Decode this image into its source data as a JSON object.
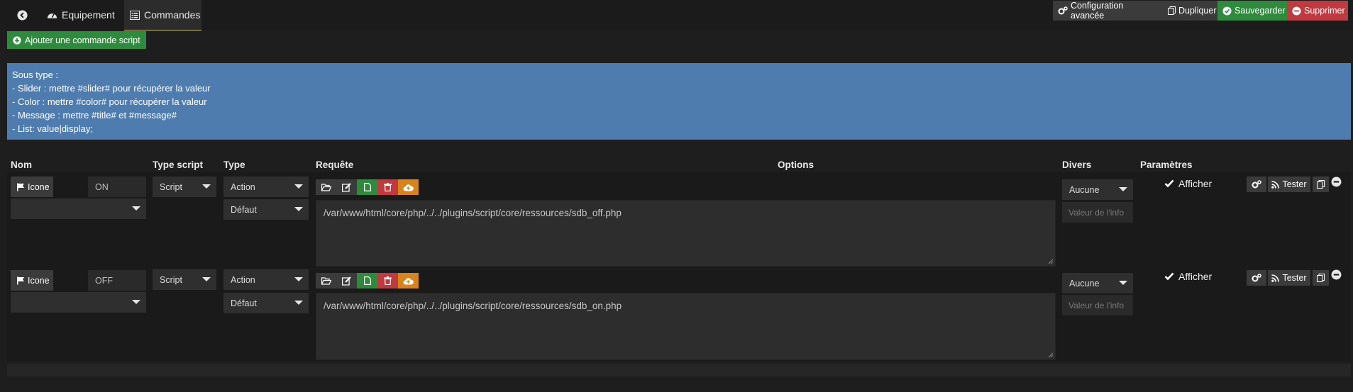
{
  "tabs": {
    "back_icon": "arrow-left-circle-icon",
    "equipement": "Equipement",
    "commandes": "Commandes"
  },
  "toolbar": {
    "config_avancee": "Configuration avancée",
    "dupliquer": "Dupliquer",
    "sauvegarder": "Sauvegarder",
    "supprimer": "Supprimer"
  },
  "add_command": "Ajouter une commande script",
  "info_box": {
    "line1": "Sous type :",
    "line2": "- Slider : mettre #slider# pour récupérer la valeur",
    "line3": "- Color : mettre #color# pour récupérer la valeur",
    "line4": "- Message : mettre #title# et #message#",
    "line5": "- List: value|display;"
  },
  "table": {
    "headers": {
      "nom": "Nom",
      "type_script": "Type script",
      "type": "Type",
      "requete": "Requête",
      "options": "Options",
      "divers": "Divers",
      "parametres": "Paramètres"
    },
    "rows": [
      {
        "icone": "Icone",
        "name": "ON",
        "type_script": "Script",
        "type": "Action",
        "subtype": "Défaut",
        "request": "/var/www/html/core/php/../../plugins/script/core/ressources/sdb_off.php",
        "divers": "Aucune",
        "valeur_placeholder": "Valeur de l'info",
        "afficher": "Afficher",
        "tester": "Tester"
      },
      {
        "icone": "Icone",
        "name": "OFF",
        "type_script": "Script",
        "type": "Action",
        "subtype": "Défaut",
        "request": "/var/www/html/core/php/../../plugins/script/core/ressources/sdb_on.php",
        "divers": "Aucune",
        "valeur_placeholder": "Valeur de l'info",
        "afficher": "Afficher",
        "tester": "Tester"
      }
    ]
  },
  "colors": {
    "info_bg": "#4f7cae",
    "green": "#2e8b3d",
    "red": "#c0393f",
    "orange": "#d7831e"
  }
}
